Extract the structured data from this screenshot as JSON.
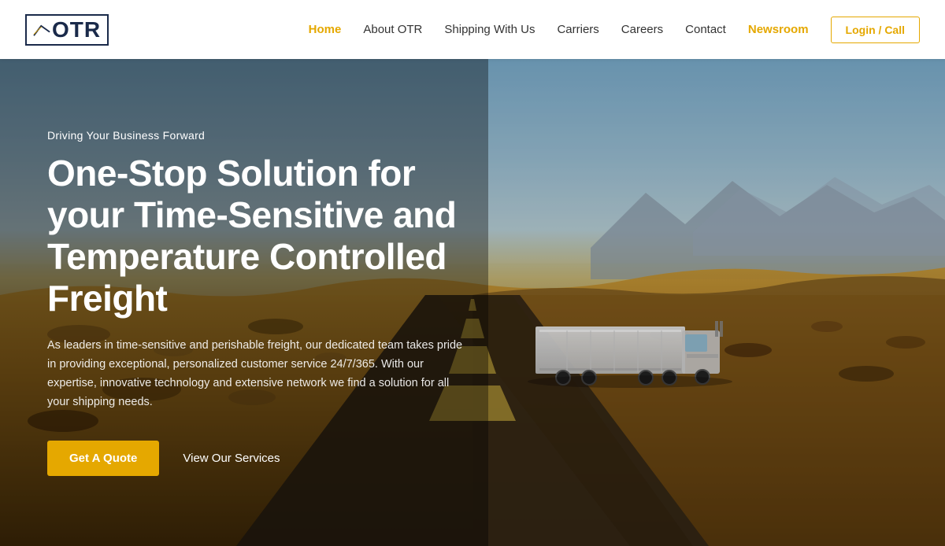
{
  "header": {
    "logo_text": "OTR",
    "nav_items": [
      {
        "label": "Home",
        "active": true,
        "highlight": false
      },
      {
        "label": "About OTR",
        "active": false,
        "highlight": false
      },
      {
        "label": "Shipping With Us",
        "active": false,
        "highlight": false
      },
      {
        "label": "Carriers",
        "active": false,
        "highlight": false
      },
      {
        "label": "Careers",
        "active": false,
        "highlight": false
      },
      {
        "label": "Contact",
        "active": false,
        "highlight": false
      },
      {
        "label": "Newsroom",
        "active": false,
        "highlight": true
      }
    ],
    "login_button_label": "Login / Call"
  },
  "hero": {
    "tagline": "Driving Your Business Forward",
    "title": "One-Stop Solution for your Time-Sensitive and Temperature Controlled Freight",
    "description": "As leaders in time-sensitive and perishable freight, our dedicated team takes pride in providing exceptional, personalized customer service 24/7/365. With our expertise, innovative technology and extensive network we find a solution for all your shipping needs.",
    "cta_primary": "Get A Quote",
    "cta_secondary": "View Our Services"
  },
  "colors": {
    "accent": "#e5a800",
    "dark_navy": "#1a2a4a",
    "white": "#ffffff"
  }
}
